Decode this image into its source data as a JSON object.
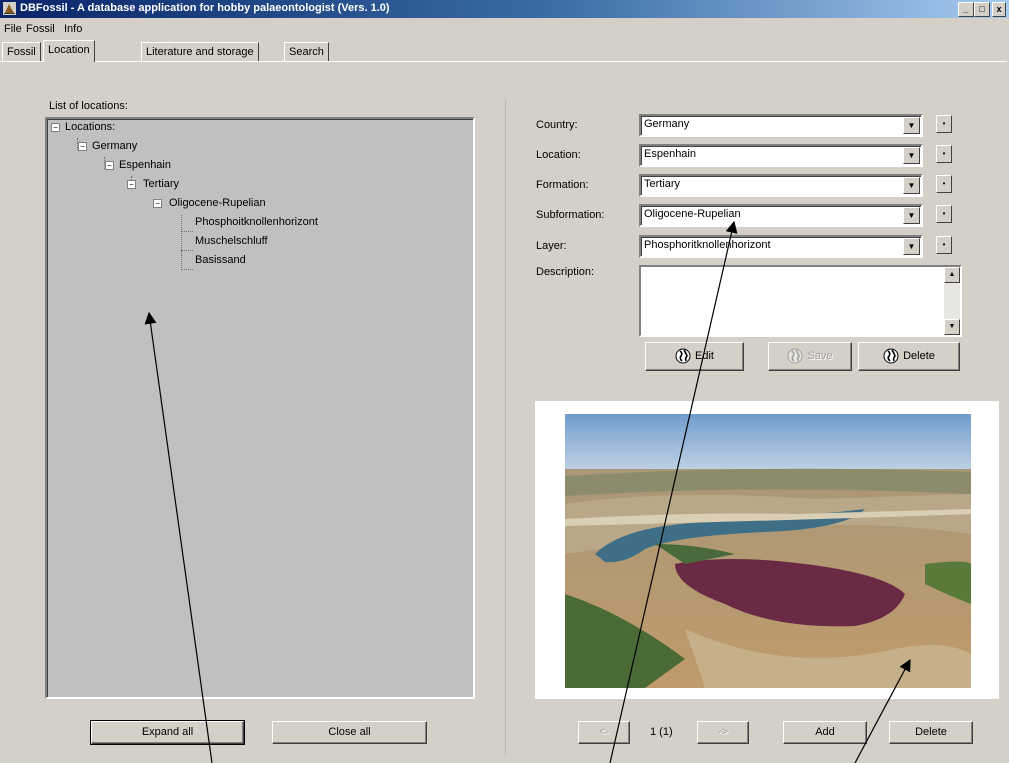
{
  "window": {
    "title": "DBFossil - A database application for hobby palaeontologist (Vers. 1.0)",
    "minimize": "_",
    "maximize": "□",
    "close": "x"
  },
  "menu": [
    "File",
    "Fossil",
    "Info"
  ],
  "tabs": [
    "Fossil",
    "Location",
    "Literature and storage",
    "Search"
  ],
  "active_tab": "Location",
  "tree_panel": {
    "label": "List of locations:",
    "nodes": {
      "root": "Locations:",
      "country": "Germany",
      "location": "Espenhain",
      "formation": "Tertiary",
      "subformation": "Oligocene-Rupelian",
      "layer1": "Phosphoitknollenhorizont",
      "layer2": "Muschelschluff",
      "layer3": "Basissand"
    },
    "expand_all": "Expand all",
    "close_all": "Close all"
  },
  "form": {
    "country_label": "Country:",
    "country_value": "Germany",
    "location_label": "Location:",
    "location_value": "Espenhain",
    "formation_label": "Formation:",
    "formation_value": "Tertiary",
    "subformation_label": "Subformation:",
    "subformation_value": "Oligocene-Rupelian",
    "layer_label": "Layer:",
    "layer_value": "Phosphoritknollenhorizont",
    "description_label": "Description:",
    "description_value": "",
    "edit": "Edit",
    "save": "Save",
    "delete": "Delete"
  },
  "image_nav": {
    "prev": "<-",
    "counter": "1 (1)",
    "next": "->",
    "add": "Add",
    "delete": "Delete"
  },
  "colors": {
    "window_bg": "#d4d0c8",
    "title_start": "#0a246a",
    "title_end": "#a6caf0",
    "tree_bg": "#c0c0c0"
  }
}
